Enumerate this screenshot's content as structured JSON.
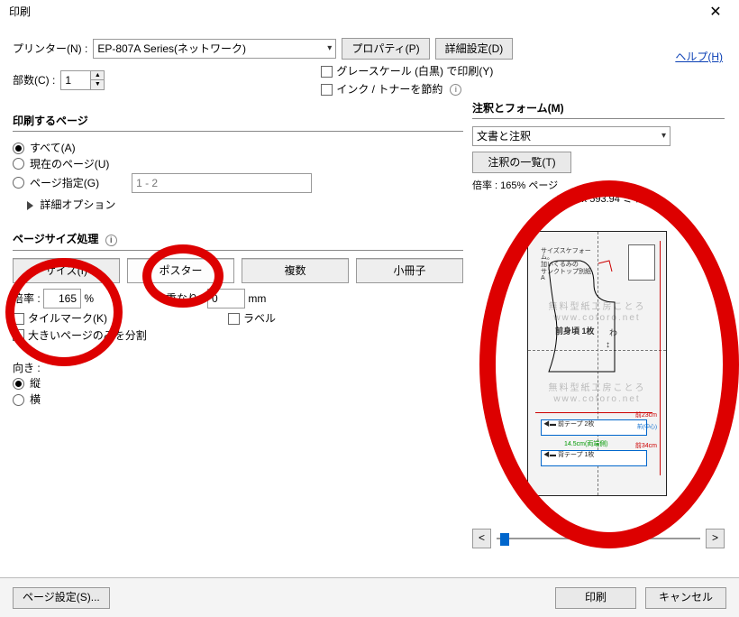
{
  "window": {
    "title": "印刷",
    "close_icon": "✕"
  },
  "help": {
    "label": "ヘルプ(H)"
  },
  "printer": {
    "label": "プリンター(N) :",
    "selected": "EP-807A Series(ネットワーク)",
    "properties_btn": "プロパティ(P)",
    "advanced_btn": "詳細設定(D)"
  },
  "copies": {
    "label": "部数(C) :",
    "value": "1"
  },
  "options": {
    "grayscale": "グレースケール (白黒) で印刷(Y)",
    "save_ink": "インク / トナーを節約"
  },
  "pages": {
    "title": "印刷するページ",
    "all": "すべて(A)",
    "current": "現在のページ(U)",
    "range_label": "ページ指定(G)",
    "range_value": "1 - 2",
    "more": "詳細オプション"
  },
  "sizehandling": {
    "title": "ページサイズ処理",
    "tabs": {
      "size": "サイズ(I)",
      "poster": "ポスター",
      "multiple": "複数",
      "booklet": "小冊子"
    },
    "scale_label": "倍率 :",
    "scale_value": "165",
    "scale_unit": "%",
    "overlap_label": "重なり :",
    "overlap_value": "0",
    "overlap_unit": "mm",
    "tilemarks": "タイルマーク(K)",
    "labels": "ラベル",
    "bigpages": "大きいページのみを分割"
  },
  "orientation": {
    "title": "向き :",
    "portrait": "縦",
    "landscape": "横"
  },
  "annotations": {
    "title": "注釈とフォーム(M)",
    "selected": "文書と注釈",
    "summary_btn": "注釈の一覧(T)"
  },
  "preview": {
    "zoom_label": "倍率 : 165% ページ",
    "dims": "419.1 x 593.94 ミリ",
    "prev": "<",
    "next": ">",
    "pattern_note1": "サイズスケフォーム。",
    "pattern_note2": "加いくるみの",
    "pattern_note3": "サンクトップ別紙A",
    "piece_label": "前身頃  1枚",
    "wa": "わ",
    "wm1": "無料型紙工房ことろ",
    "wm2": "www.cotoro.net",
    "band1": "前テープ  2枚",
    "band1_len": "前23cm",
    "band1_note": "前(中心)",
    "band2_len": "14.5cm(両端側)",
    "band2": "背テープ  1枚",
    "band2_len2": "前34cm"
  },
  "footer": {
    "pagesetup": "ページ設定(S)...",
    "print": "印刷",
    "cancel": "キャンセル"
  }
}
